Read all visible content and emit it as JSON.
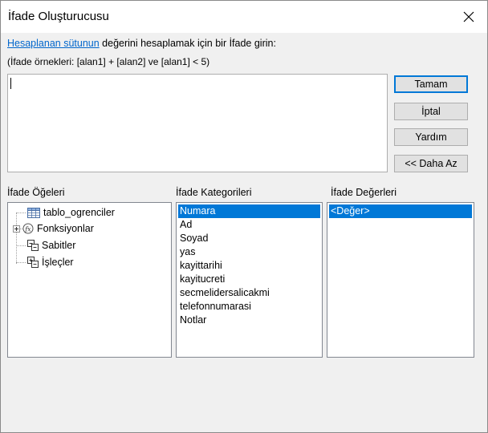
{
  "window": {
    "title": "İfade Oluşturucusu",
    "close_icon": "close-icon"
  },
  "instructions": {
    "link": "Hesaplanan sütunun",
    "rest": " değerini hesaplamak için bir İfade girin:",
    "examples": "(İfade örnekleri: [alan1] + [alan2] ve [alan1] < 5)"
  },
  "expression": {
    "value": ""
  },
  "buttons": {
    "ok": "Tamam",
    "cancel": "İptal",
    "help": "Yardım",
    "less": "<< Daha Az"
  },
  "panels": {
    "elements": {
      "label": "İfade Öğeleri",
      "items": [
        "tablo_ogrenciler",
        "Fonksiyonlar",
        "Sabitler",
        "İşleçler"
      ]
    },
    "categories": {
      "label": "İfade Kategorileri",
      "items": [
        "Numara",
        "Ad",
        "Soyad",
        "yas",
        "kayittarihi",
        "kayitucreti",
        "secmelidersalicakmi",
        "telefonnumarasi",
        "Notlar"
      ],
      "selected": "Numara"
    },
    "values": {
      "label": "İfade Değerleri",
      "items": [
        "<Değer>"
      ],
      "selected": "<Değer>"
    }
  },
  "colors": {
    "selection": "#0078d7",
    "link": "#0066cc",
    "dialog_bg": "#f0f0f0"
  }
}
